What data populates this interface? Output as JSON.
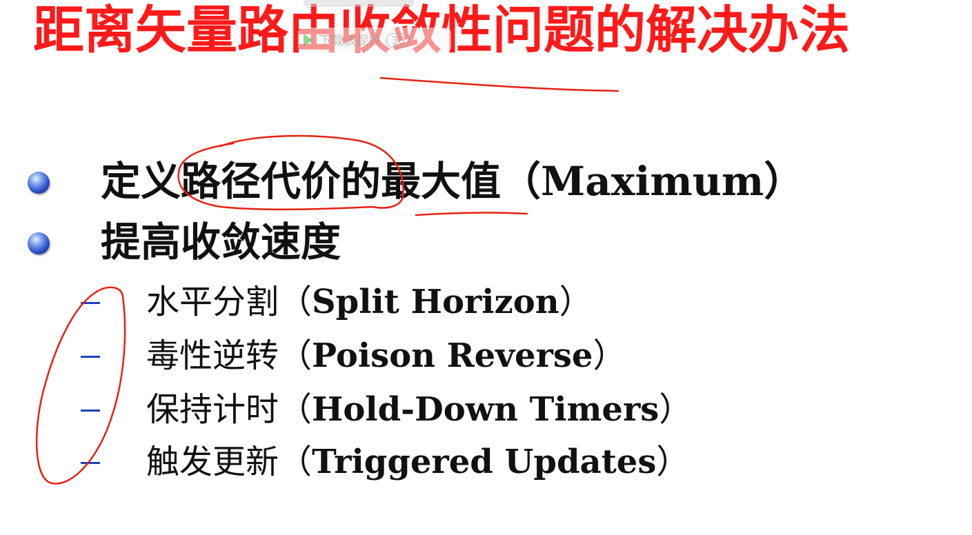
{
  "title": "距离矢量路由收敛性问题的解决办法",
  "overlay": {
    "label": "下载该视频",
    "badge": "38"
  },
  "level1": [
    {
      "text": "定义路径代价的最大值（Maximum）"
    },
    {
      "text": "提高收敛速度"
    }
  ],
  "level2": [
    {
      "zh": "水平分割（",
      "en": "Split Horizon",
      "close": "）"
    },
    {
      "zh": "毒性逆转（",
      "en": "Poison Reverse",
      "close": "）"
    },
    {
      "zh": "保持计时（",
      "en": "Hold-Down Timers",
      "close": "）"
    },
    {
      "zh": "触发更新（",
      "en": "Triggered Updates",
      "close": "）"
    }
  ],
  "colors": {
    "title": "#ff1a1a",
    "annotation": "#e8200f",
    "bullet": "#2a4fc9",
    "dash": "#1f3fbf"
  }
}
